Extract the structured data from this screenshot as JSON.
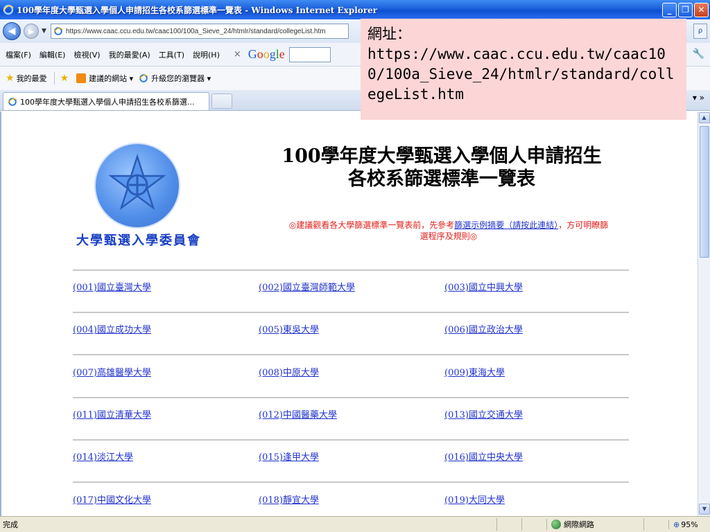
{
  "window": {
    "title": "100學年度大學甄選入學個人申請招生各校系篩選標準一覽表 - Windows Internet Explorer",
    "minimize": "_",
    "maximize": "❐",
    "close": "✕"
  },
  "address_bar": {
    "url": "https://www.caac.ccu.edu.tw/caac100/100a_Sieve_24/htmlr/standard/collegeList.htm",
    "search_go": "ρ"
  },
  "menu": {
    "items": [
      "檔案(F)",
      "編輯(E)",
      "檢視(V)",
      "我的最愛(A)",
      "工具(T)",
      "說明(H)"
    ],
    "google_close": "×"
  },
  "favorites": {
    "my_favorites": "我的最愛",
    "suggested_sites": "建議的網站 ▾",
    "upgrade_browser": "升級您的瀏覽器 ▾"
  },
  "tabs": {
    "active_title": "100學年度大學甄選入學個人申請招生各校系篩選...",
    "more": "▾ »"
  },
  "url_overlay": {
    "label": "網址：",
    "url": "https://www.caac.ccu.edu.tw/caac100/100a_Sieve_24/htmlr/standard/collegeList.htm"
  },
  "page": {
    "committee": "大學甄選入學委員會",
    "title_line1": "100學年度大學甄選入學個人申請招生",
    "title_line2": "各校系篩選標準一覽表",
    "notice_before": "◎建議觀看各大學篩選標準一覽表前，先參考",
    "notice_link": "篩選示例摘要（請按此連結）",
    "notice_after": "，方可明瞭篩選程序及規則◎",
    "universities": [
      [
        "(001)國立臺灣大學",
        "(002)國立臺灣師範大學",
        "(003)國立中興大學"
      ],
      [
        "(004)國立成功大學",
        "(005)東吳大學",
        "(006)國立政治大學"
      ],
      [
        "(007)高雄醫學大學",
        "(008)中原大學",
        "(009)東海大學"
      ],
      [
        "(011)國立清華大學",
        "(012)中國醫藥大學",
        "(013)國立交通大學"
      ],
      [
        "(014)淡江大學",
        "(015)逢甲大學",
        "(016)國立中央大學"
      ],
      [
        "(017)中國文化大學",
        "(018)靜宜大學",
        "(019)大同大學"
      ]
    ]
  },
  "status": {
    "text": "完成",
    "zone": "網際網路",
    "zoom": "95%"
  }
}
